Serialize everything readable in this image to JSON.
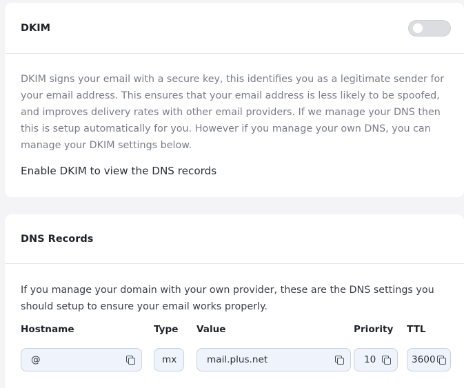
{
  "dkim": {
    "title": "DKIM",
    "toggle_enabled": false,
    "description": "DKIM signs your email with a secure key, this identifies you as a legitimate sender for your email address. This ensures that your email address is less likely to be spoofed, and improves delivery rates with other email providers. If we manage your DNS then this is setup automatically for you. However if you manage your own DNS, you can manage your DKIM settings below.",
    "enable_note": "Enable DKIM to view the DNS records"
  },
  "dns": {
    "title": "DNS Records",
    "description": "If you manage your domain with your own provider, these are the DNS settings you should setup to ensure your email works properly.",
    "headers": {
      "hostname": "Hostname",
      "type": "Type",
      "value": "Value",
      "priority": "Priority",
      "ttl": "TTL"
    },
    "record": {
      "hostname": "@",
      "type": "mx",
      "value": "mail.plus.net",
      "priority": "10",
      "ttl": "3600"
    }
  },
  "colors": {
    "page_bg": "#f4f4f6",
    "card_bg": "#ffffff",
    "field_bg": "#eff3fc",
    "field_border": "#c9d0e6",
    "toggle_off": "#dcdde1"
  },
  "icons": [
    "copy-icon"
  ]
}
